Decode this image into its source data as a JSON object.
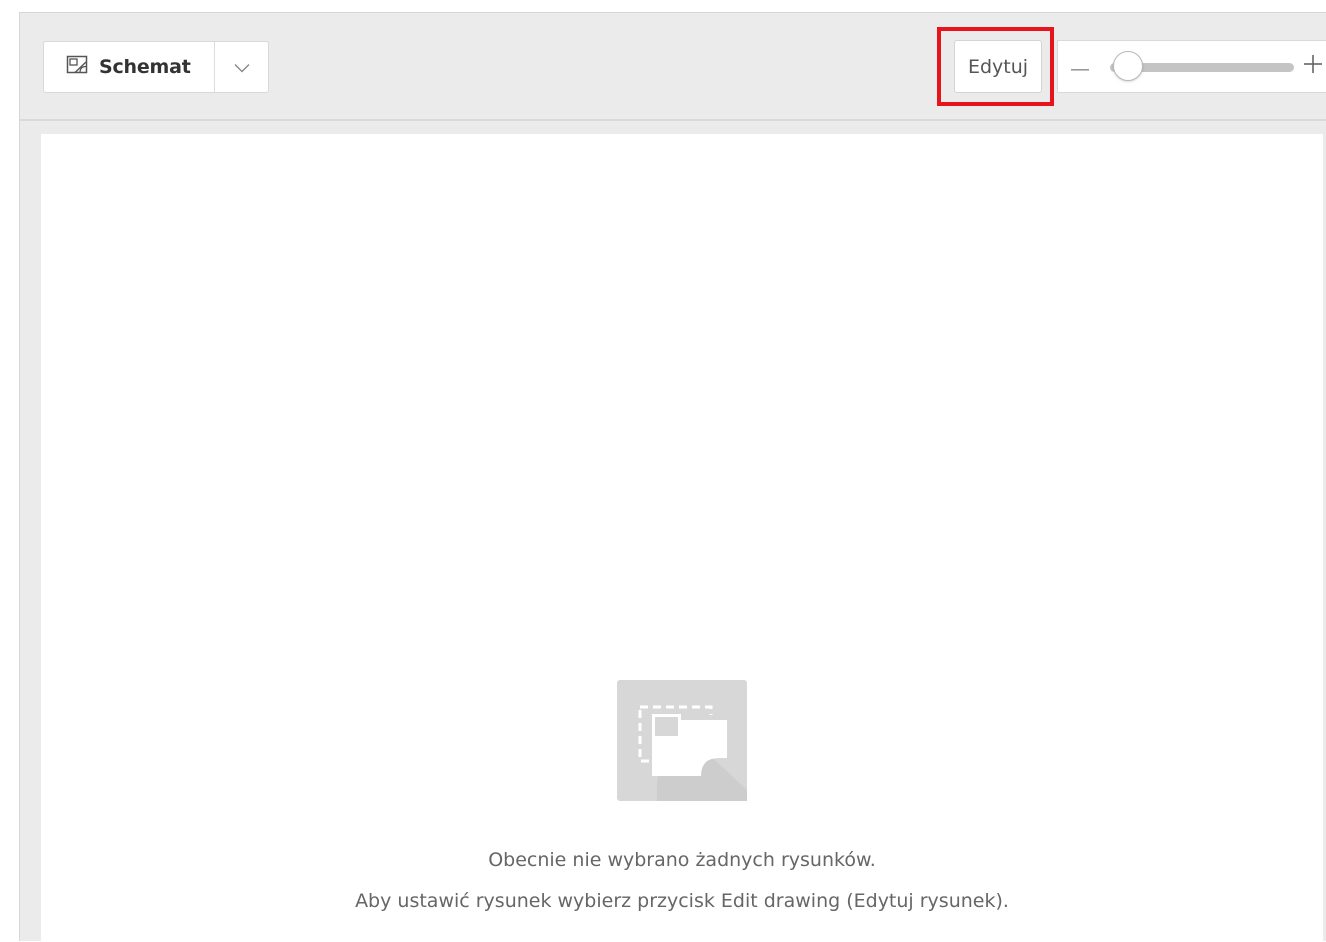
{
  "toolbar": {
    "view_select": {
      "label": "Schemat",
      "icon": "drawing-icon",
      "dropdown_icon": "chevron-down-icon"
    },
    "edit_button_label": "Edytuj",
    "zoom": {
      "minus_icon": "minus-icon",
      "plus_icon": "plus-icon",
      "level_fraction": 0.1
    },
    "highlight_color": "#e8141b"
  },
  "canvas": {
    "empty_state": {
      "icon": "no-drawing-icon",
      "line1": "Obecnie nie wybrano żadnych rysunków.",
      "line2": "Aby ustawić rysunek wybierz przycisk Edit drawing (Edytuj rysunek)."
    }
  }
}
